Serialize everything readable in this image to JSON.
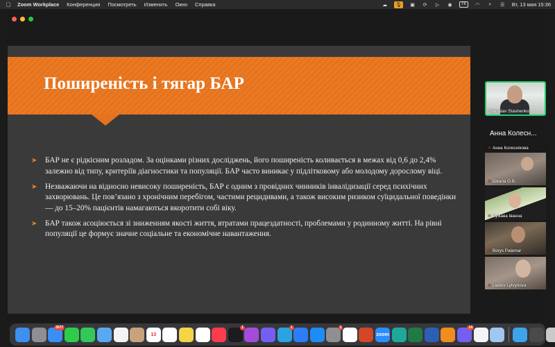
{
  "menubar": {
    "app_name": "Zoom Workplace",
    "items": [
      "Конференция",
      "Посмотреть",
      "Изменить",
      "Окно",
      "Справка"
    ],
    "keyboard_layout": "УК",
    "clock": "Вт, 13 мая 15:36"
  },
  "slide": {
    "title": "Поширеність і тягар БАР",
    "accent_color": "#ea7a24",
    "background_color": "#3a3a3a",
    "bullets": [
      "БАР не є рідкісним розладом. За оцінками різних досліджень, його поширеність коливається в межах від 0,6 до 2,4% залежно від типу, критеріїв діагностики та популяції. БАР часто виникає у підлітковому або молодому дорослому віці.",
      "Незважаючи на відносно невисоку поширеність, БАР є одним з провідних чинників інвалідизації серед психічних захворювань. Це пов’язано з хронічним перебігом, частими рецидивами, а також високим ризиком суїцидальної поведінки — до 15–20% пацієнтів намагаються вкоротити собі віку.",
      "БАР також асоціюється зі зниженням якості життя, втратами працездатності, проблемами у родинному житті. На рівні популяції це формує значне соціальне та економічне навантаження."
    ]
  },
  "participants": {
    "active_speaker": "Stanislav Stashenko",
    "big_name": "Анна Колесн...",
    "list": [
      {
        "name": "Анна Колеснікова"
      },
      {
        "name": "Шкала О.В."
      },
      {
        "name": "Бужава Іванна"
      },
      {
        "name": "Borys Palamar"
      },
      {
        "name": "Liubov Lytvynova"
      }
    ]
  },
  "dock": {
    "apps": [
      {
        "icon": "finder-icon",
        "color": "#3d8ff0",
        "label": ""
      },
      {
        "icon": "launchpad-icon",
        "color": "#8e8e93",
        "label": ""
      },
      {
        "icon": "mail-icon",
        "color": "#3a8ef5",
        "badge": "3677"
      },
      {
        "icon": "facetime-icon",
        "color": "#2ecc4a",
        "label": ""
      },
      {
        "icon": "messages-icon",
        "color": "#34c759",
        "label": ""
      },
      {
        "icon": "maps-icon",
        "color": "#5aa9f0",
        "label": ""
      },
      {
        "icon": "photos-icon",
        "color": "#f4f4f4",
        "label": ""
      },
      {
        "icon": "contacts-icon",
        "color": "#c8a27a",
        "label": ""
      },
      {
        "icon": "calendar-icon",
        "color": "#ffffff",
        "label": "13"
      },
      {
        "icon": "reminders-icon",
        "color": "#ffffff",
        "label": ""
      },
      {
        "icon": "notes-icon",
        "color": "#f5d547",
        "label": ""
      },
      {
        "icon": "freeform-icon",
        "color": "#ffffff",
        "label": ""
      },
      {
        "icon": "music-icon",
        "color": "#fa3c4c",
        "label": ""
      },
      {
        "icon": "tv-icon",
        "color": "#1c1c1e",
        "badge": "1"
      },
      {
        "icon": "podcasts-icon",
        "color": "#a64bd9",
        "label": ""
      },
      {
        "icon": "viber-icon",
        "color": "#7360f2",
        "label": ""
      },
      {
        "icon": "telegram-icon",
        "color": "#2aa3e0",
        "badge": "1"
      },
      {
        "icon": "keynote-icon",
        "color": "#2d7df6",
        "label": ""
      },
      {
        "icon": "appstore-icon",
        "color": "#1e8cf5",
        "label": ""
      },
      {
        "icon": "settings-icon",
        "color": "#8e8e93",
        "badge": "1"
      },
      {
        "icon": "sheets-icon",
        "color": "#ffffff",
        "label": ""
      },
      {
        "icon": "powerpoint-icon",
        "color": "#d24726",
        "label": ""
      },
      {
        "icon": "zoom-icon",
        "color": "#2d8cff",
        "label": "zoom"
      },
      {
        "icon": "clario-icon",
        "color": "#1fa89a",
        "label": ""
      },
      {
        "icon": "excel-icon",
        "color": "#1f7a45",
        "label": ""
      },
      {
        "icon": "word-icon",
        "color": "#2b5fb3",
        "label": ""
      },
      {
        "icon": "vlc-icon",
        "color": "#f28c1e",
        "label": ""
      },
      {
        "icon": "viber-icon",
        "color": "#7360f2",
        "badge": "14"
      },
      {
        "icon": "chrome-icon",
        "color": "#f4f4f4",
        "label": ""
      },
      {
        "icon": "preview-icon",
        "color": "#9fc7f0",
        "label": ""
      },
      {
        "icon": "downloads-folder-icon",
        "color": "#3ea3e8",
        "label": ""
      },
      {
        "icon": "screenshot-icon",
        "color": "#4a4a4a",
        "label": ""
      },
      {
        "icon": "trash-icon",
        "color": "#c9c9c9",
        "label": ""
      }
    ]
  }
}
